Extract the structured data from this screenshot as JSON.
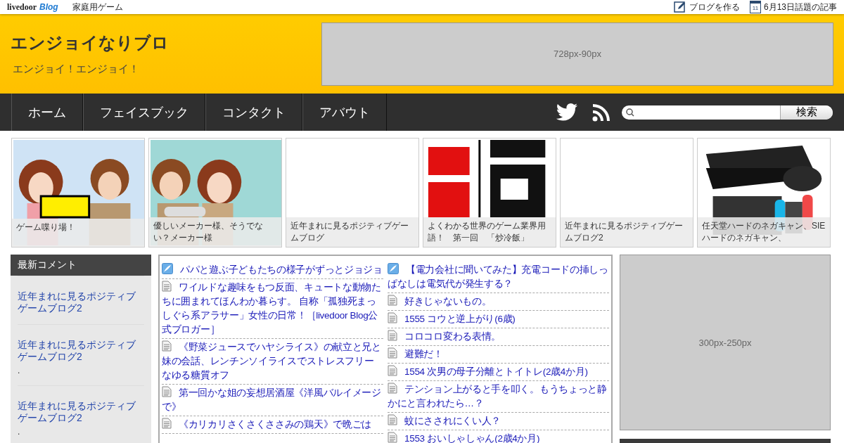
{
  "topbar": {
    "logo": "livedoor",
    "logo_blog": "Blog",
    "category": "家庭用ゲーム",
    "links": [
      {
        "kind": "pencil",
        "label": "ブログを作る"
      },
      {
        "kind": "calendar",
        "label": "6月13日話題の記事",
        "icon_text": "11"
      }
    ]
  },
  "header": {
    "title": "エンジョイなりブロ",
    "subtitle": "エンジョイ！エンジョイ！",
    "ad": "728px-90px"
  },
  "nav": {
    "items": [
      {
        "label": "ホーム"
      },
      {
        "label": "フェイスブック"
      },
      {
        "label": "コンタクト"
      },
      {
        "label": "アバウト"
      }
    ],
    "search": {
      "button": "検索"
    }
  },
  "featured": [
    {
      "kind": "picture",
      "caption": "ゲーム喋り場！"
    },
    {
      "kind": "picture",
      "caption": "優しいメーカー様、そうでない？メーカー様"
    },
    {
      "kind": "none",
      "caption": "近年まれに見るポジティブゲームブログ"
    },
    {
      "kind": "picture",
      "caption": "よくわかる世界のゲーム業界用語！　第一回　「炒冷飯」"
    },
    {
      "kind": "none",
      "caption": "近年まれに見るポジティブゲームブログ2"
    },
    {
      "kind": "picture",
      "caption": "任天堂ハードのネガキャン、SIEハードのネガキャン、"
    }
  ],
  "sidebar": {
    "title": "最新コメント",
    "items": [
      {
        "title": "近年まれに見るポジティブゲームブログ2"
      },
      {
        "title": "近年まれに見るポジティブゲームブログ2",
        "note": "."
      },
      {
        "title": "近年まれに見るポジティブゲームブログ2",
        "note": "."
      }
    ]
  },
  "feed": {
    "columns": [
      [
        {
          "kind": "feather",
          "title": "パパと遊ぶ子どもたちの様子がずっとジョジョ"
        },
        {
          "kind": "doc",
          "title": "ワイルドな趣味をもつ反面、キュートな動物たちに囲まれてほんわか暮らす。 自称「孤独死まっしぐら系アラサー」女性の日常！［livedoor Blog公式ブロガー］"
        },
        {
          "kind": "doc",
          "title": "《野菜ジュースでハヤシライス》の献立と兄と妹の会話、レンチンソイライスでストレスフリーなゆる糖質オフ"
        },
        {
          "kind": "doc",
          "title": "第一回かな姐の妄想居酒屋《洋風バルイメージで》"
        },
        {
          "kind": "doc",
          "title": "《カリカリさくさくささみの鶏天》で晩ごは"
        }
      ],
      [
        {
          "kind": "feather",
          "title": "【電力会社に聞いてみた】充電コードの挿しっぱなしは電気代が発生する？"
        },
        {
          "kind": "doc",
          "title": "好きじゃないもの。"
        },
        {
          "kind": "doc",
          "title": "1555 コウと逆上がり(6歳)"
        },
        {
          "kind": "doc",
          "title": "コロコロ変わる表情。"
        },
        {
          "kind": "doc",
          "title": "避難だ！"
        },
        {
          "kind": "doc",
          "title": "1554 次男の母子分離とトイトレ(2歳4か月)"
        },
        {
          "kind": "doc",
          "title": "テンション上がると手を叩く。もうちょっと静かにと言われたら…？"
        },
        {
          "kind": "doc",
          "title": "蚊にさされにくい人？"
        },
        {
          "kind": "doc",
          "title": "1553 おいしゃしゃん(2歳4か月)"
        }
      ]
    ]
  },
  "right_ad": "300px-250px"
}
